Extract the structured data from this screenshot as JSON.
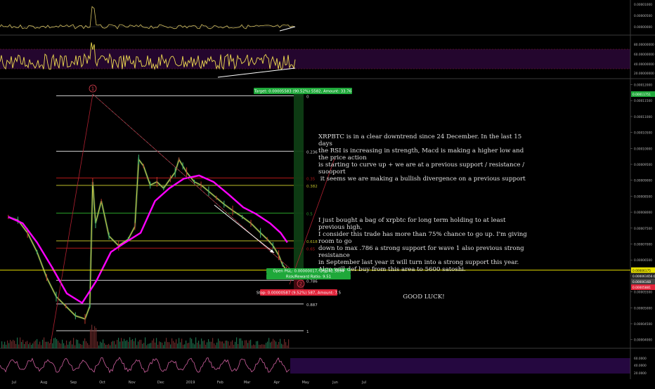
{
  "chart_data": {
    "type": "line",
    "x_ticks": [
      "Jul",
      "Aug",
      "Sep",
      "Oct",
      "Nov",
      "Dec",
      "2019",
      "Feb",
      "Mar",
      "Apr",
      "May",
      "Jun",
      "Jul"
    ],
    "y_axis": {
      "ticks": [
        "0.00012000",
        "0.00011500",
        "0.00011000",
        "0.00010500",
        "0.00010000",
        "0.00009500",
        "0.00009000",
        "0.00008500",
        "0.00008000",
        "0.00007500",
        "0.00007000",
        "0.00006500",
        "0.00006000",
        "0.00005500",
        "0.00005000",
        "0.00004500",
        "0.00004000"
      ],
      "ylim": [
        3.95e-05,
        0.000121
      ]
    },
    "price_labels": {
      "top": "0.00011751",
      "current": "0.00006175",
      "current_label_b": "0.0000616",
      "current_label_c": "0.0000616B",
      "timer": "56:09",
      "stop": "0.00005881"
    },
    "series": [
      {
        "name": "Price",
        "x": [
          "2018-06-25",
          "2018-07-05",
          "2018-07-15",
          "2018-07-25",
          "2018-08-04",
          "2018-08-14",
          "2018-08-24",
          "2018-09-03",
          "2018-09-13",
          "2018-09-18",
          "2018-09-21",
          "2018-09-24",
          "2018-09-30",
          "2018-10-08",
          "2018-10-18",
          "2018-10-28",
          "2018-11-04",
          "2018-11-08",
          "2018-11-13",
          "2018-11-20",
          "2018-11-27",
          "2018-12-04",
          "2018-12-11",
          "2018-12-16",
          "2018-12-20",
          "2018-12-24",
          "2018-12-28",
          "2019-01-05",
          "2019-01-12",
          "2019-01-20",
          "2019-01-28",
          "2019-02-05",
          "2019-02-14",
          "2019-02-24",
          "2019-03-05",
          "2019-03-15",
          "2019-03-22",
          "2019-03-28",
          "2019-04-03",
          "2019-04-07",
          "2019-04-11"
        ],
        "values": [
          7.85e-05,
          7.75e-05,
          7.35e-05,
          6.75e-05,
          5.95e-05,
          5.35e-05,
          5.05e-05,
          4.75e-05,
          4.65e-05,
          5.05e-05,
          8.95e-05,
          7.65e-05,
          8.35e-05,
          7.25e-05,
          6.95e-05,
          7.15e-05,
          7.55e-05,
          9.65e-05,
          9.45e-05,
          8.85e-05,
          8.95e-05,
          8.75e-05,
          9.05e-05,
          9.25e-05,
          9.65e-05,
          9.45e-05,
          9.25e-05,
          8.95e-05,
          8.85e-05,
          8.65e-05,
          8.45e-05,
          8.25e-05,
          8.05e-05,
          7.85e-05,
          7.65e-05,
          7.35e-05,
          7.15e-05,
          6.95e-05,
          6.65e-05,
          6.35e-05,
          6.18e-05
        ]
      },
      {
        "name": "MA",
        "x": [
          "2018-06-25",
          "2018-07-10",
          "2018-07-25",
          "2018-08-10",
          "2018-08-25",
          "2018-09-10",
          "2018-09-25",
          "2018-10-10",
          "2018-10-25",
          "2018-11-10",
          "2018-11-25",
          "2018-12-10",
          "2018-12-25",
          "2019-01-10",
          "2019-01-25",
          "2019-02-10",
          "2019-02-25",
          "2019-03-10",
          "2019-03-25",
          "2019-04-05",
          "2019-04-12"
        ],
        "values": [
          7.85e-05,
          7.65e-05,
          7.05e-05,
          6.25e-05,
          5.45e-05,
          5.15e-05,
          5.85e-05,
          6.75e-05,
          7.05e-05,
          7.35e-05,
          8.35e-05,
          8.75e-05,
          9.05e-05,
          9.15e-05,
          8.95e-05,
          8.55e-05,
          8.15e-05,
          7.95e-05,
          7.65e-05,
          7.35e-05,
          7.05e-05
        ]
      }
    ],
    "fib_levels": [
      {
        "label": "0",
        "value": 0.0001165
      },
      {
        "label": "0.236",
        "value": 9.91e-05
      },
      {
        "label": "0.35",
        "value": 9.07e-05
      },
      {
        "label": "0.382",
        "value": 8.84e-05
      },
      {
        "label": "0.5",
        "value": 7.97e-05
      },
      {
        "label": "0.618",
        "value": 7.1e-05
      },
      {
        "label": "0.65",
        "value": 6.87e-05
      },
      {
        "label": "0.786",
        "value": 5.86e-05
      },
      {
        "label": "0.887",
        "value": 5.12e-05
      },
      {
        "label": "1",
        "value": 4.28e-05
      }
    ],
    "wave_labels": [
      "1",
      "2"
    ],
    "target_label": "Target: 0.00005583 (90.52%) 5582, Amount: 33.76",
    "position_label_a": "Open P&L: 0.00000017, Qty: 42.5894",
    "position_label_b": "Risk/Reward Ratio: 9.51",
    "stop_label": "Stop: 0.00000587 (9.52%) 587, Amount: 7.5",
    "macd_ticks": [
      "0.00001000",
      "0.00000500",
      "0.00000000"
    ],
    "rsi_ticks": [
      "80.00000000",
      "60.00000000",
      "40.00000000",
      "20.00000000"
    ],
    "bottom_ticks": [
      "60.0000",
      "40.0000",
      "20.0000"
    ]
  },
  "annotation": {
    "paragraph1": "XRPBTC is in a clear downtrend since 24 December. In the last 15 days\nthe RSI is increasing in strength, Macd is making a higher low and the price action\nis starting to curve up + we are at a previous support / resistance / suooport\n it seems we are making a bullish divergence on a previous support",
    "paragraph2": "I just bought a bag of xrpbtc for long term holding to at least previous high,\nI consider this trade has more than 75% chance to go up. I'm giving room to go\ndown to max .786 a strong support for wave 1 also previous strong resistance\nin September last year it will turn into a strong support this year.\nAlgo will def buy from this area to 5600 satoshi.",
    "closing": "GOOD LUCK!"
  },
  "colors": {
    "background": "#000000",
    "price": "#c8c84a",
    "ma": "#ff00ff",
    "macd": "#d4c060",
    "rsi": "#f0dc50",
    "target_green": "#1fa83a",
    "stop_red": "#e0243a",
    "current_yellow": "#e8e000",
    "fib_white": "#d0d0d0",
    "fib_red": "#b01818",
    "fib_yellow": "#bcbc28",
    "fib_green": "#28a028"
  }
}
